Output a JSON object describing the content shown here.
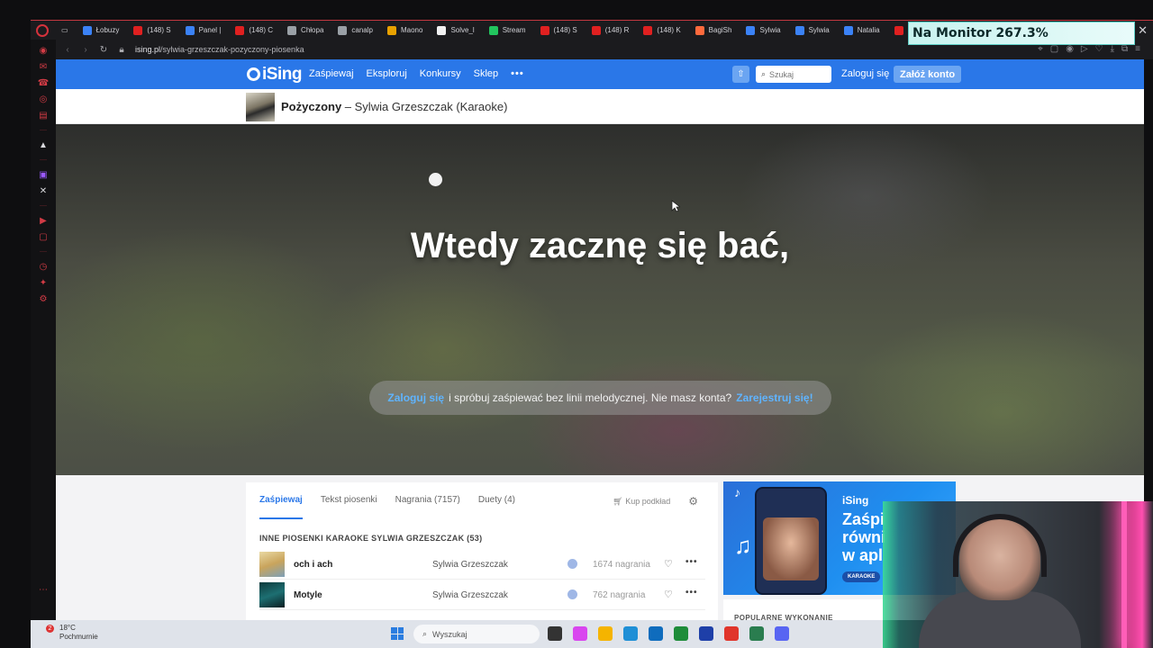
{
  "browser": {
    "tabs": [
      {
        "label": "Łobuzy",
        "color": "#3b82f6"
      },
      {
        "label": "(148) S",
        "color": "#e02020"
      },
      {
        "label": "Panel |",
        "color": "#3b82f6"
      },
      {
        "label": "(148) C",
        "color": "#e02020"
      },
      {
        "label": "Chłopa",
        "color": "#9aa0a6"
      },
      {
        "label": "canalp",
        "color": "#9aa0a6"
      },
      {
        "label": "Maono",
        "color": "#e8a100"
      },
      {
        "label": "Solve_l",
        "color": "#f1f1f1"
      },
      {
        "label": "Stream",
        "color": "#22c55e"
      },
      {
        "label": "(148) S",
        "color": "#e02020"
      },
      {
        "label": "(148) R",
        "color": "#e02020"
      },
      {
        "label": "(148) K",
        "color": "#e02020"
      },
      {
        "label": "BagiSh",
        "color": "#ff6a3d"
      },
      {
        "label": "Sylwia",
        "color": "#3b82f6"
      },
      {
        "label": "Sylwia",
        "color": "#3b82f6"
      },
      {
        "label": "Natalia",
        "color": "#3b82f6"
      },
      {
        "label": "(14",
        "color": "#e02020"
      }
    ],
    "url_host": "ising.pl",
    "url_path": "/sylwia-grzeszczak-pozyczony-piosenka"
  },
  "overlay": {
    "monitor_text": "Na Monitor 267.3%"
  },
  "site": {
    "logo": "iSing",
    "nav": [
      "Zaśpiewaj",
      "Eksploruj",
      "Konkursy",
      "Sklep"
    ],
    "nav_more": "•••",
    "search_placeholder": "Szukaj",
    "login": "Zaloguj się",
    "signup": "Załóż konto"
  },
  "song": {
    "title": "Pożyczony",
    "subtitle": " – Sylwia Grzeszczak (Karaoke)"
  },
  "player": {
    "lyric": "Wtedy zacznę się bać,",
    "notice_login": "Zaloguj się",
    "notice_text": "i spróbuj zaśpiewać bez linii melodycznej. Nie masz konta?",
    "notice_register": "Zarejestruj się!"
  },
  "content": {
    "tabs": [
      "Zaśpiewaj",
      "Tekst piosenki",
      "Nagrania (7157)",
      "Duety (4)"
    ],
    "buy": "Kup podkład",
    "section_title": "INNE PIOSENKI KARAOKE SYLWIA GRZESZCZAK (53)",
    "songs": [
      {
        "name": "och i ach",
        "artist": "Sylwia Grzeszczak",
        "recordings": "1674 nagrania"
      },
      {
        "name": "Motyle",
        "artist": "Sylwia Grzeszczak",
        "recordings": "762 nagrania"
      }
    ]
  },
  "promo": {
    "logo": "iSing",
    "text": "Zaśpi\nrówni\nw apl",
    "badge": "KARAOKE"
  },
  "popular": "POPULARNE WYKONANIE",
  "taskbar": {
    "badge": "2",
    "temp": "18°C",
    "weather": "Pochmurnie",
    "search": "Wyszukaj",
    "icons": [
      "#333333",
      "#d946ef",
      "#f5b400",
      "#1f8fd6",
      "#0f6cbd",
      "#1e8c3a",
      "#1e3fa8",
      "#e0352b",
      "#2a7d4f",
      "#5865f2"
    ]
  }
}
